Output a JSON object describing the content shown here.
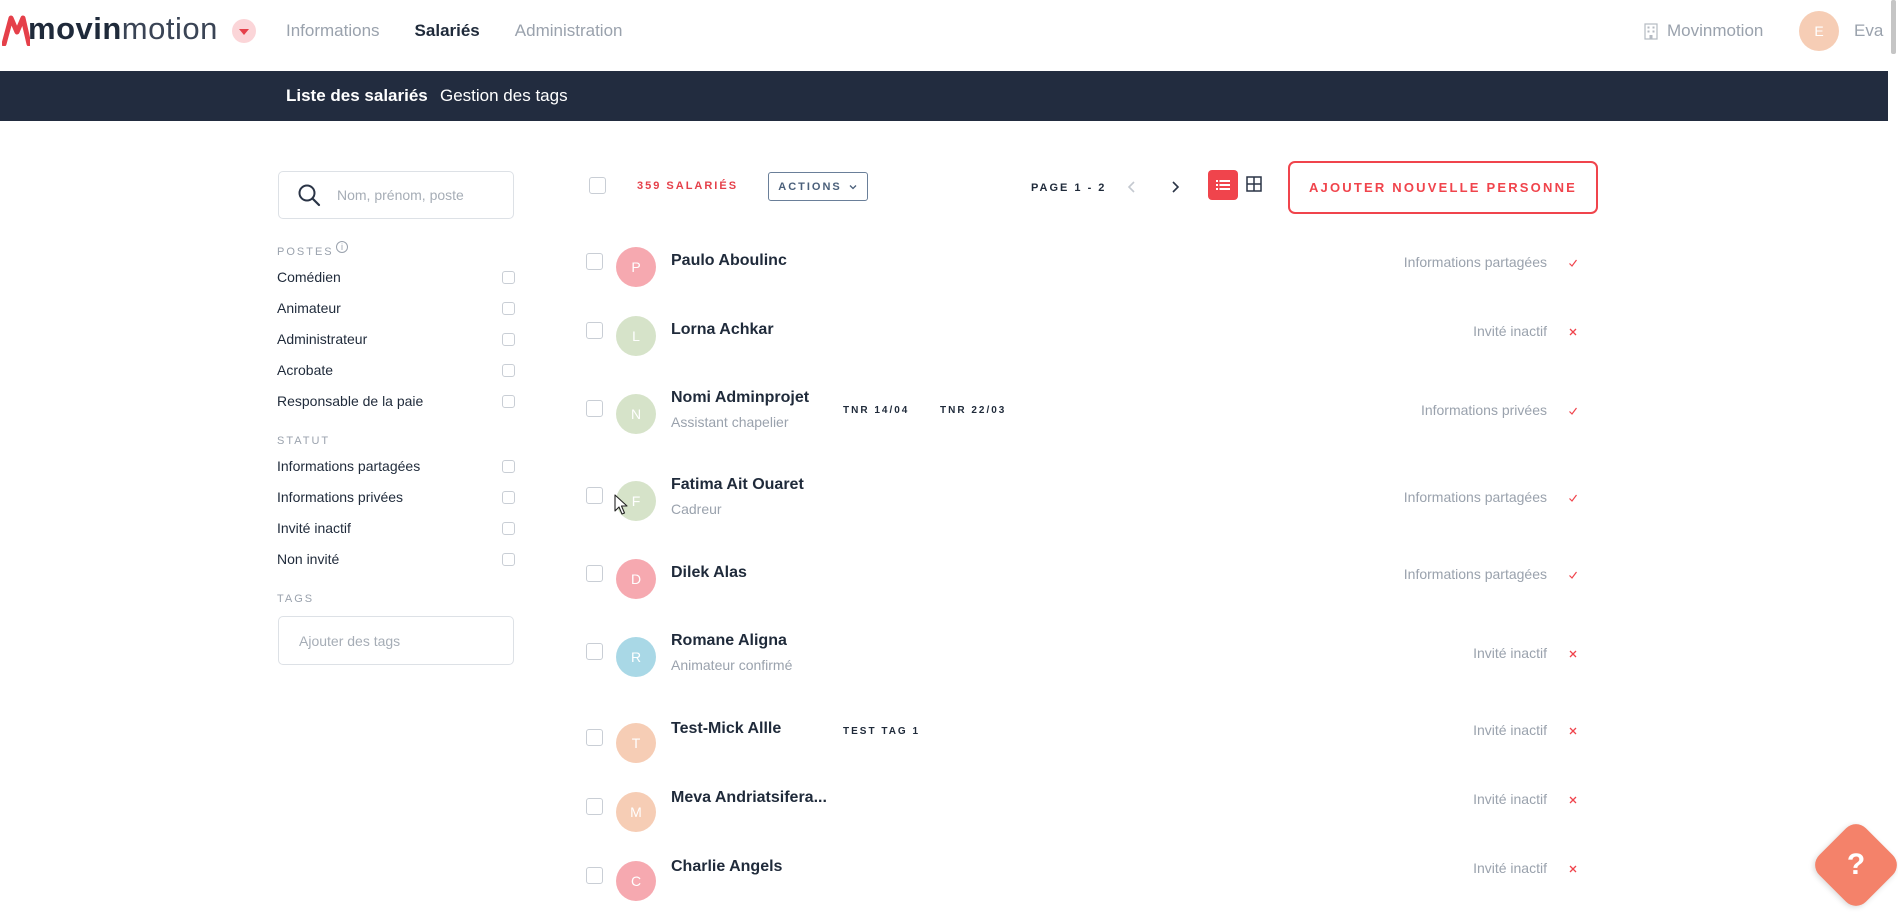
{
  "brand": {
    "bold": "movin",
    "light": "motion",
    "accent": "#e5404a"
  },
  "nav": {
    "items": [
      {
        "label": "Informations",
        "active": false
      },
      {
        "label": "Salariés",
        "active": true
      },
      {
        "label": "Administration",
        "active": false
      }
    ],
    "company": "Movinmotion",
    "user": {
      "initial": "E",
      "name": "Eva"
    }
  },
  "subnav": {
    "items": [
      {
        "label": "Liste des salariés",
        "active": true
      },
      {
        "label": "Gestion des tags",
        "active": false
      }
    ]
  },
  "sidebar": {
    "search_placeholder": "Nom, prénom, poste",
    "postes_label": "POSTES",
    "postes": [
      "Comédien",
      "Animateur",
      "Administrateur",
      "Acrobate",
      "Responsable de la paie"
    ],
    "statut_label": "STATUT",
    "statuts": [
      "Informations partagées",
      "Informations privées",
      "Invité inactif",
      "Non invité"
    ],
    "tags_label": "TAGS",
    "tags_placeholder": "Ajouter des tags"
  },
  "list": {
    "count_label": "359 SALARIÉS",
    "actions_label": "ACTIONS",
    "page_label": "PAGE 1 - 2",
    "add_label": "AJOUTER NOUVELLE PERSONNE"
  },
  "employees": [
    {
      "initial": "P",
      "name": "Paulo Aboulinc",
      "job": "",
      "tags": [],
      "status": "Informations partagées",
      "mark": "check",
      "color": "#f6a9b0"
    },
    {
      "initial": "L",
      "name": "Lorna Achkar",
      "job": "",
      "tags": [],
      "status": "Invité inactif",
      "mark": "cross",
      "color": "#d6e3c9"
    },
    {
      "initial": "N",
      "name": "Nomi Adminprojet",
      "job": "Assistant chapelier",
      "tags": [
        "TNR 14/04",
        "TNR 22/03"
      ],
      "status": "Informations privées",
      "mark": "check",
      "color": "#d6e3c9"
    },
    {
      "initial": "F",
      "name": "Fatima Ait Ouaret",
      "job": "Cadreur",
      "tags": [],
      "status": "Informations partagées",
      "mark": "check",
      "color": "#d6e3c9"
    },
    {
      "initial": "D",
      "name": "Dilek Alas",
      "job": "",
      "tags": [],
      "status": "Informations partagées",
      "mark": "check",
      "color": "#f6a9b0"
    },
    {
      "initial": "R",
      "name": "Romane Aligna",
      "job": "Animateur confirmé",
      "tags": [],
      "status": "Invité inactif",
      "mark": "cross",
      "color": "#a9d8e6"
    },
    {
      "initial": "T",
      "name": "Test-Mick Allle",
      "job": "",
      "tags": [
        "TEST TAG 1"
      ],
      "status": "Invité inactif",
      "mark": "cross",
      "color": "#f6cdb5"
    },
    {
      "initial": "M",
      "name": "Meva Andriatsifera...",
      "job": "",
      "tags": [],
      "status": "Invité inactif",
      "mark": "cross",
      "color": "#f6cdb5"
    },
    {
      "initial": "C",
      "name": "Charlie Angels",
      "job": "",
      "tags": [],
      "status": "Invité inactif",
      "mark": "cross",
      "color": "#f6a9b0"
    }
  ],
  "help_label": "?"
}
